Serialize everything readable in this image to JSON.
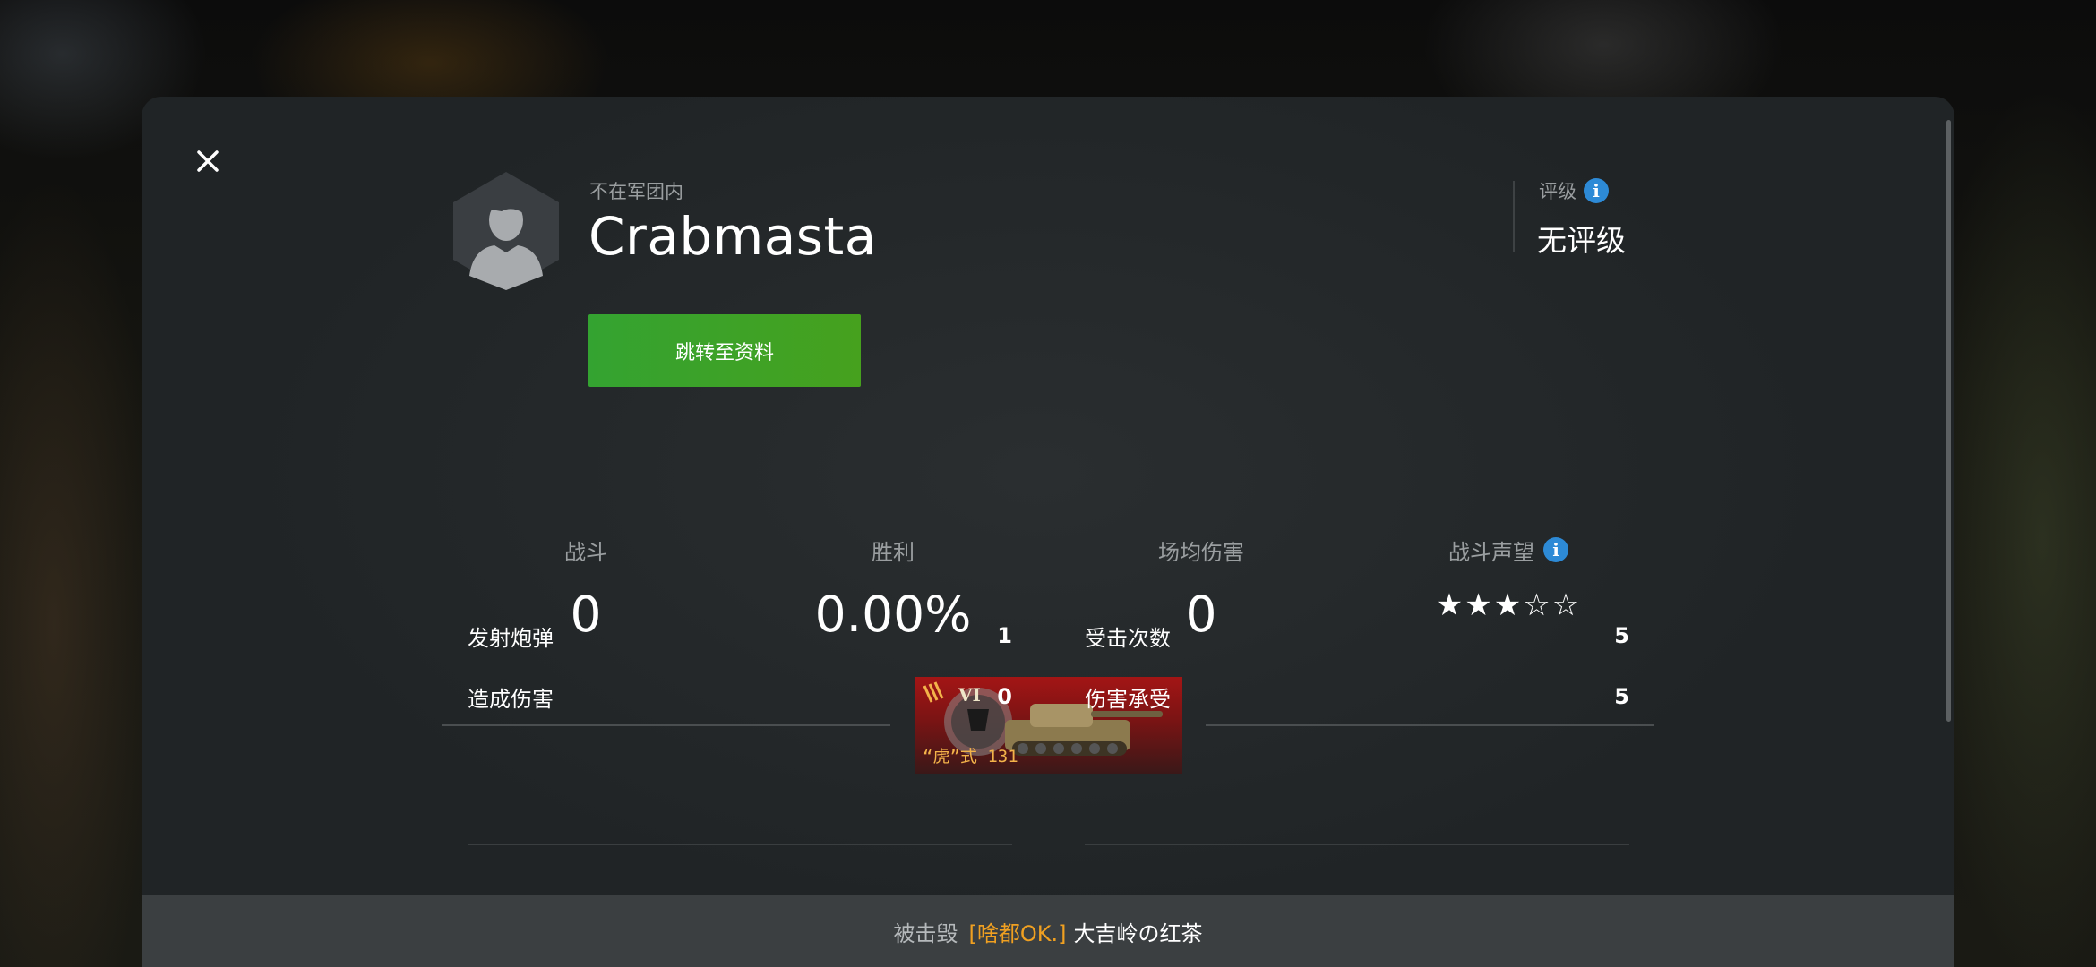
{
  "player": {
    "clan_status": "不在军团内",
    "name": "Crabmasta",
    "profile_button_label": "跳转至资料"
  },
  "rating": {
    "label": "评级",
    "value": "无评级",
    "info_icon": "info-icon"
  },
  "stats": [
    {
      "label": "战斗",
      "value": "0"
    },
    {
      "label": "胜利",
      "value": "0.00%"
    },
    {
      "label": "场均伤害",
      "value": "0"
    },
    {
      "label": "战斗声望",
      "value": "★★★☆☆",
      "stars_filled": 3,
      "stars_total": 5
    }
  ],
  "tank": {
    "tier": "VI",
    "name": "“虎”式 131",
    "nation": "germany"
  },
  "details": {
    "left": [
      {
        "label": "发射炮弹",
        "value": "1"
      },
      {
        "label": "造成伤害",
        "value": "0"
      }
    ],
    "right": [
      {
        "label": "受击次数",
        "value": "5"
      },
      {
        "label": "伤害承受",
        "value": "5"
      }
    ]
  },
  "footer": {
    "prefix": "被击毁",
    "killer_clan": "[啥都OK.]",
    "killer_name": "大吉岭の红茶"
  },
  "colors": {
    "accent_green": "#3aa02a",
    "clan_orange": "#f0a021",
    "info_blue": "#2d8ad6",
    "tank_card_red": "#a31515"
  }
}
